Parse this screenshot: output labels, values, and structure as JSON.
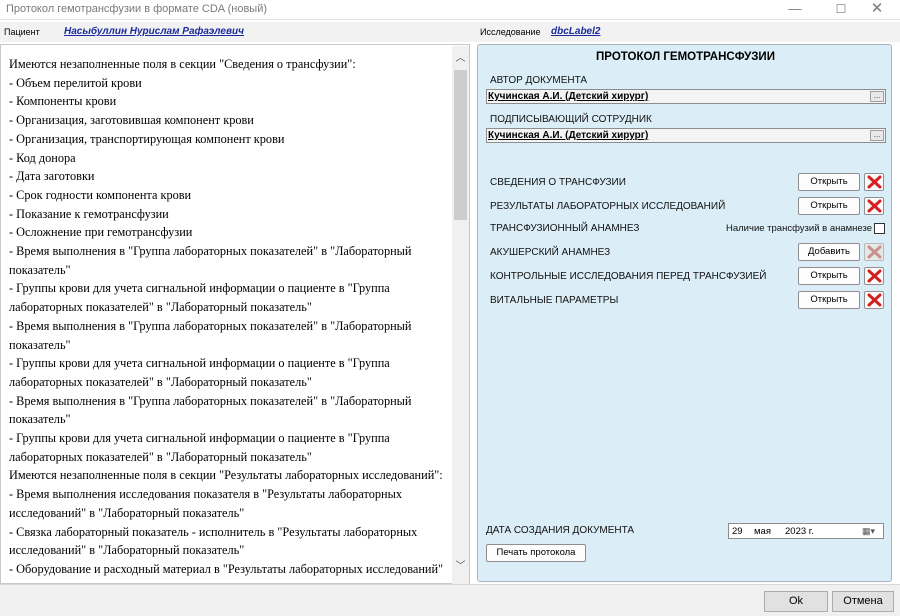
{
  "window": {
    "title": "Протокол гемотрансфузии в формате CDA (новый)",
    "controls": {
      "minimize": "—",
      "maximize": "☐",
      "close": "✕"
    }
  },
  "patient": {
    "label": "Пациент",
    "name": "Насыбуллин Нурислам Рафаэлевич"
  },
  "study": {
    "label": "Исследование",
    "value": "dbcLabel2"
  },
  "warnings": [
    "Имеются незаполненные поля в секции \"Сведения о трансфузии\":",
    "- Объем перелитой крови",
    "- Компоненты крови",
    "- Организация, заготовившая компонент крови",
    "- Организация, транспортирующая компонент крови",
    "- Код донора",
    "- Дата заготовки",
    "- Срок годности компонента крови",
    "- Показание к гемотрансфузии",
    "- Осложнение при гемотрансфузии",
    "- Время выполнения в \"Группа лабораторных показателей\" в \"Лабораторный показатель\"",
    "- Группы крови для учета сигнальной информации о пациенте в \"Группа лабораторных показателей\" в \"Лабораторный показатель\"",
    "- Время выполнения в \"Группа лабораторных показателей\" в \"Лабораторный показатель\"",
    "- Группы крови для учета сигнальной информации о пациенте в \"Группа лабораторных показателей\" в \"Лабораторный показатель\"",
    "- Время выполнения в \"Группа лабораторных показателей\" в \"Лабораторный показатель\"",
    "- Группы крови для учета сигнальной информации о пациенте в \"Группа лабораторных показателей\" в \"Лабораторный показатель\"",
    "Имеются незаполненные поля в секции \"Результаты лабораторных исследований\":",
    "- Время выполнения исследования показателя в \"Результаты лабораторных исследований\" в \"Лабораторный показатель\"",
    "- Связка лабораторный показатель - исполнитель в \"Результаты лабораторных исследований\" в \"Лабораторный показатель\"",
    "- Оборудование и расходный материал в \"Результаты лабораторных исследований\" в \"Лабораторный показатель\""
  ],
  "protocol": {
    "title": "ПРОТОКОЛ ГЕМОТРАНСФУЗИИ",
    "author_label": "АВТОР ДОКУМЕНТА",
    "author_value": "Кучинская А.И. (Детский хирург)",
    "signer_label": "ПОДПИСЫВАЮЩИЙ СОТРУДНИК",
    "signer_value": "Кучинская А.И. (Детский хирург)",
    "ellipsis": "...",
    "sections": {
      "transfusion": {
        "label": "СВЕДЕНИЯ О ТРАНСФУЗИИ",
        "button": "Открыть"
      },
      "lab_results": {
        "label": "РЕЗУЛЬТАТЫ ЛАБОРАТОРНЫХ ИССЛЕДОВАНИЙ",
        "button": "Открыть"
      },
      "anamnesis": {
        "label": "ТРАНСФУЗИОННЫЙ АНАМНЕЗ",
        "checkbox_label": "Наличие трансфузий в анамнезе",
        "checked": false
      },
      "obstetric": {
        "label": "АКУШЕРСКИЙ АНАМНЕЗ",
        "button": "Добавить"
      },
      "control": {
        "label": "КОНТРОЛЬНЫЕ ИССЛЕДОВАНИЯ ПЕРЕД ТРАНСФУЗИЕЙ",
        "button": "Открыть"
      },
      "vital": {
        "label": "ВИТАЛЬНЫЕ ПАРАМЕТРЫ",
        "button": "Открыть"
      }
    },
    "creation_date_label": "ДАТА СОЗДАНИЯ ДОКУМЕНТА",
    "date": {
      "day": "29",
      "month": "мая",
      "year": "2023 г."
    },
    "print_button": "Печать протокола"
  },
  "footer": {
    "ok": "Ok",
    "cancel": "Отмена"
  },
  "colors": {
    "panel_bg": "#dbeef7",
    "link": "#1a2a9c",
    "delete_red": "#d42020"
  }
}
